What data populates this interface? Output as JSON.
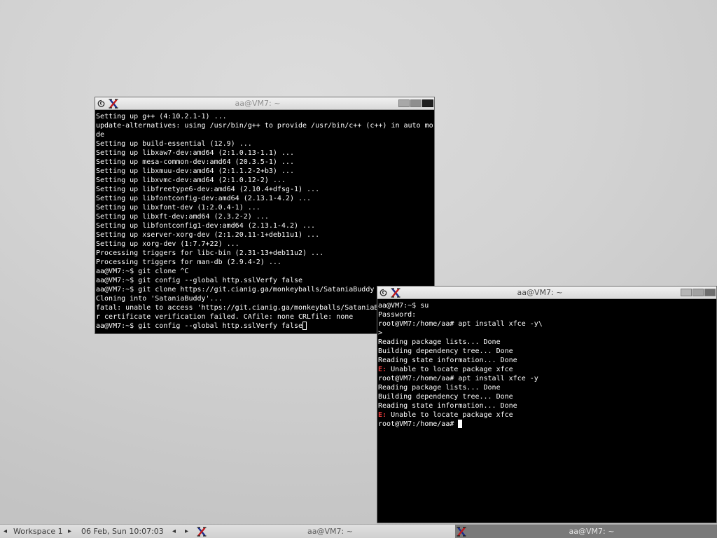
{
  "colors": {
    "terminal_bg": "#000000",
    "terminal_fg": "#ffffff",
    "error": "#e23a3a",
    "task_active_bg": "#7a7a7a",
    "title_inactive": "#8f8f8f",
    "title_active": "#4a4a4a"
  },
  "icons": {
    "window_menu": "debian-icon",
    "app": "xterm-icon",
    "prev": "arrow-left-icon",
    "next": "arrow-right-icon"
  },
  "windows": [
    {
      "title": "aa@VM7: ~",
      "lines": [
        "Setting up g++ (4:10.2.1-1) ...",
        "update-alternatives: using /usr/bin/g++ to provide /usr/bin/c++ (c++) in auto mo",
        "de",
        "Setting up build-essential (12.9) ...",
        "Setting up libxaw7-dev:amd64 (2:1.0.13-1.1) ...",
        "Setting up mesa-common-dev:amd64 (20.3.5-1) ...",
        "Setting up libxmuu-dev:amd64 (2:1.1.2-2+b3) ...",
        "Setting up libxvmc-dev:amd64 (2:1.0.12-2) ...",
        "Setting up libfreetype6-dev:amd64 (2.10.4+dfsg-1) ...",
        "Setting up libfontconfig-dev:amd64 (2.13.1-4.2) ...",
        "Setting up libxfont-dev (1:2.0.4-1) ...",
        "Setting up libxft-dev:amd64 (2.3.2-2) ...",
        "Setting up libfontconfig1-dev:amd64 (2.13.1-4.2) ...",
        "Setting up xserver-xorg-dev (2:1.20.11-1+deb11u1) ...",
        "Setting up xorg-dev (1:7.7+22) ...",
        "Processing triggers for libc-bin (2.31-13+deb11u2) ...",
        "Processing triggers for man-db (2.9.4-2) ...",
        "aa@VM7:~$ git clone ^C",
        "aa@VM7:~$ git config --global http.sslVerfy false",
        "aa@VM7:~$ git clone https://git.cianig.ga/monkeyballs/SataniaBuddy",
        "Cloning into 'SataniaBuddy'...",
        "fatal: unable to access 'https://git.cianig.ga/monkeyballs/SataniaB",
        "r certificate verification failed. CAfile: none CRLfile: none",
        "aa@VM7:~$ git config --global http.sslVerfy false"
      ]
    },
    {
      "title": "aa@VM7: ~",
      "lines": [
        "aa@VM7:~$ su",
        "Password:",
        "root@VM7:/home/aa# apt install xfce -y\\",
        ">",
        "Reading package lists... Done",
        "Building dependency tree... Done",
        "Reading state information... Done",
        {
          "tag": "E:",
          "text": " Unable to locate package xfce"
        },
        "root@VM7:/home/aa# apt install xfce -y",
        "Reading package lists... Done",
        "Building dependency tree... Done",
        "Reading state information... Done",
        {
          "tag": "E:",
          "text": " Unable to locate package xfce"
        },
        "root@VM7:/home/aa# "
      ]
    }
  ],
  "taskbar": {
    "prev_arrow": "◂",
    "next_arrow": "▸",
    "workspace": "Workspace 1",
    "clock": "06 Feb, Sun 10:07:03",
    "tasks": [
      {
        "label": "aa@VM7: ~",
        "active": false
      },
      {
        "label": "aa@VM7: ~",
        "active": true
      }
    ]
  }
}
